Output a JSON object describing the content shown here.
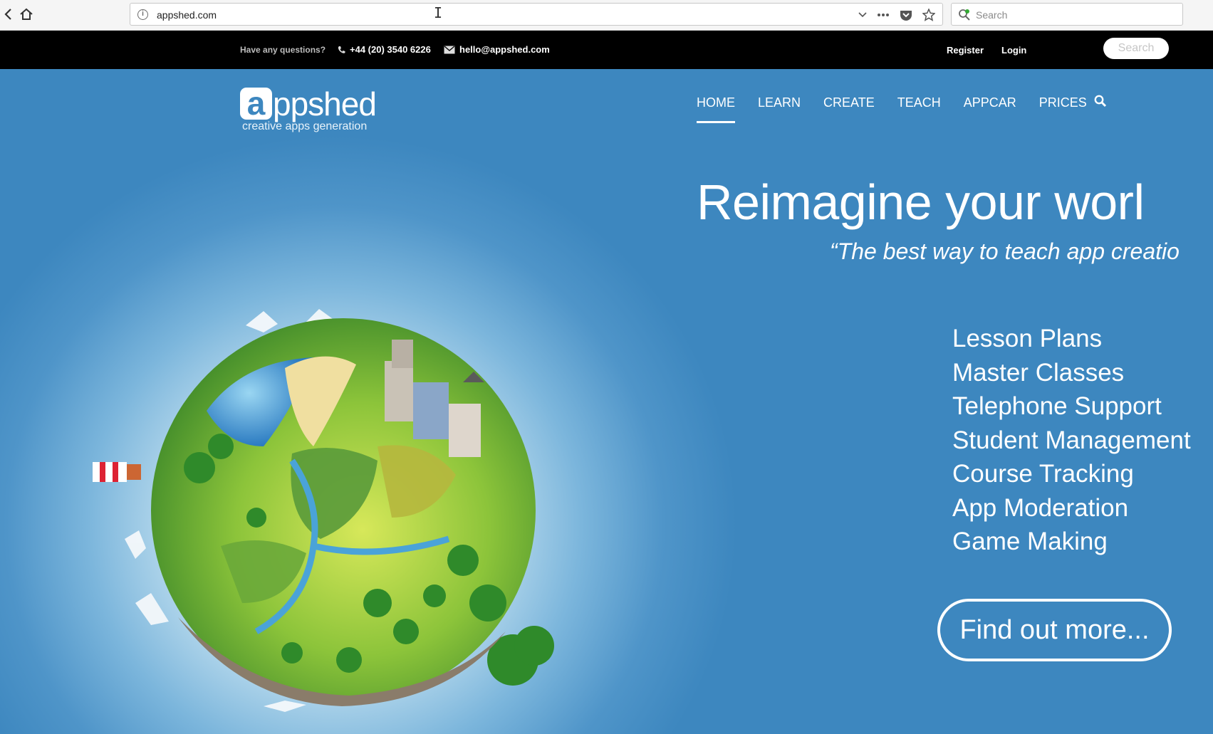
{
  "browser": {
    "url": "appshed.com",
    "search_placeholder": "Search",
    "icons": [
      "back-icon",
      "home-icon",
      "info-icon",
      "dropdown-icon",
      "more-icon",
      "pocket-icon",
      "star-icon",
      "search-icon"
    ]
  },
  "topbar": {
    "question": "Have any questions?",
    "phone": "+44 (20) 3540 6226",
    "email": "hello@appshed.com",
    "register": "Register",
    "login": "Login",
    "search_button": "Search"
  },
  "logo": {
    "mark": "a",
    "word": "ppshed",
    "tagline": "creative apps generation"
  },
  "nav": {
    "items": [
      {
        "label": "HOME",
        "active": true
      },
      {
        "label": "LEARN"
      },
      {
        "label": "CREATE"
      },
      {
        "label": "TEACH"
      },
      {
        "label": "APPCAR"
      },
      {
        "label": "PRICES"
      }
    ]
  },
  "hero": {
    "headline": "Reimagine your worl",
    "subhead": "“The best way to teach app creatio",
    "features": [
      "Lesson Plans",
      "Master Classes",
      "Telephone Support",
      "Student Management",
      "Course Tracking",
      "App Moderation",
      "Game Making"
    ],
    "cta": "Find out more..."
  },
  "colors": {
    "hero_bg": "#3d87bf",
    "topbar_bg": "#000000",
    "text": "#ffffff"
  }
}
